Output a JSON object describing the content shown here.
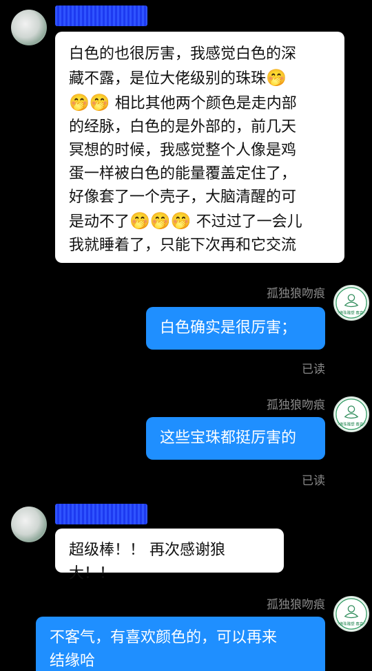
{
  "messages": [
    {
      "sender": "them",
      "text_line1": "白色的也很厉害，我感觉白色的深",
      "text_line2": "藏不露，是位大佬级别的珠珠",
      "emoji_a": "🤭",
      "emoji_b": "🤭🤭",
      "text_line3": " 相比其他两个颜色是走内部",
      "text_line4": "的经脉，白色的是外部的，前几天",
      "text_line5": "冥想的时候，我感觉整个人像是鸡",
      "text_line6": "蛋一样被白色的能量覆盖定住了，",
      "text_line7": "好像套了一个壳子，大脑清醒的可",
      "text_line8a": "是动不了",
      "emoji_c": "🤭🤭🤭",
      "text_line8b": " 不过过了一会儿",
      "text_line9": "我就睡着了，只能下次再和它交流"
    },
    {
      "sender": "me",
      "name": "孤独狼吻痕",
      "text": "白色确实是很厉害；",
      "status": "已读"
    },
    {
      "sender": "me",
      "name": "孤独狼吻痕",
      "text": "这些宝珠都挺厉害的",
      "status": "已读"
    },
    {
      "sender": "them",
      "text": "超级棒！！ 再次感谢狼大！！"
    },
    {
      "sender": "me",
      "name": "孤独狼吻痕",
      "text_line1": "不客气，有喜欢颜色的，可以再来",
      "text_line2": "结缘哈"
    }
  ],
  "avatar_me_seal_text": "陶石佛珠雕塑 春喜品何",
  "colors": {
    "background": "#000000",
    "bubble_me": "#1f8fff",
    "bubble_them": "#ffffff",
    "meta_text": "#8a8a8a"
  }
}
